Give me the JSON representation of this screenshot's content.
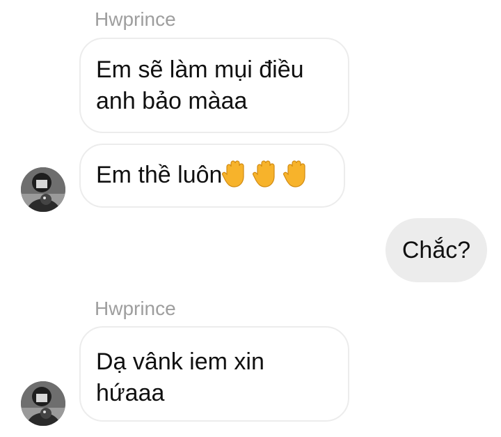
{
  "conversation": {
    "sender_name_1": "Hwprince",
    "msg1_line1": "Em sẽ làm mụi điều",
    "msg1_line2": "anh bảo màaa",
    "msg2_text": "Em thề luôn",
    "msg2_emojis": [
      "raised-hand-icon",
      "raised-hand-icon",
      "raised-hand-icon"
    ],
    "msg3_text": "Chắc?",
    "sender_name_2": "Hwprince",
    "msg4_line1": "Dạ vânk iem xin",
    "msg4_line2": "hứaaa"
  },
  "colors": {
    "incoming_border": "#ececec",
    "outgoing_bg": "#ececec",
    "sender_name": "#9e9e9e",
    "emoji_hand": "#f7b32b"
  }
}
